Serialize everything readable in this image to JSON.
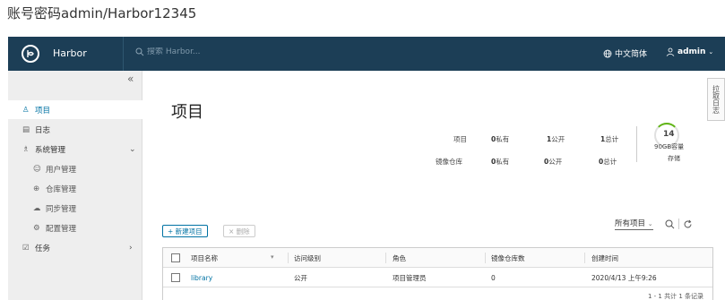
{
  "caption": "账号密码admin/Harbor12345",
  "header": {
    "brand": "Harbor",
    "search_placeholder": "搜索 Harbor...",
    "language": "中文简体",
    "user": "admin"
  },
  "sidebar": {
    "items": [
      {
        "label": "项目",
        "active": true
      },
      {
        "label": "日志"
      },
      {
        "label": "系统管理",
        "expanded": true
      },
      {
        "label": "用户管理"
      },
      {
        "label": "仓库管理"
      },
      {
        "label": "同步管理"
      },
      {
        "label": "配置管理"
      },
      {
        "label": "任务"
      }
    ]
  },
  "main": {
    "title": "项目",
    "side_tab": "拉取日志",
    "summary": {
      "row_project": {
        "label": "项目",
        "private_n": "0",
        "private_label": "私有",
        "public_n": "1",
        "public_label": "公开",
        "total_n": "1",
        "total_label": "总计"
      },
      "row_repo": {
        "label": "镜像仓库",
        "private_n": "0",
        "private_label": "私有",
        "public_n": "0",
        "public_label": "公开",
        "total_n": "0",
        "total_label": "总计"
      },
      "quota_count": "14",
      "quota_text": "90GB容量",
      "quota_label": "存储"
    },
    "new_button": "+ 新建项目",
    "delete_button": "× 删除",
    "filter_label": "所有项目",
    "table": {
      "headers": [
        "项目名称",
        "访问级别",
        "角色",
        "镜像仓库数",
        "创建时间"
      ],
      "rows": [
        {
          "name": "library",
          "access": "公开",
          "role": "项目管理员",
          "repos": "0",
          "created": "2020/4/13 上午9:26"
        }
      ],
      "footer": "1 - 1 共计 1 条记录"
    }
  },
  "colors": {
    "header_bg": "#1c3e56",
    "accent": "#0072a3",
    "sidebar_bg": "#eeeeee",
    "gauge": "#60b515"
  }
}
